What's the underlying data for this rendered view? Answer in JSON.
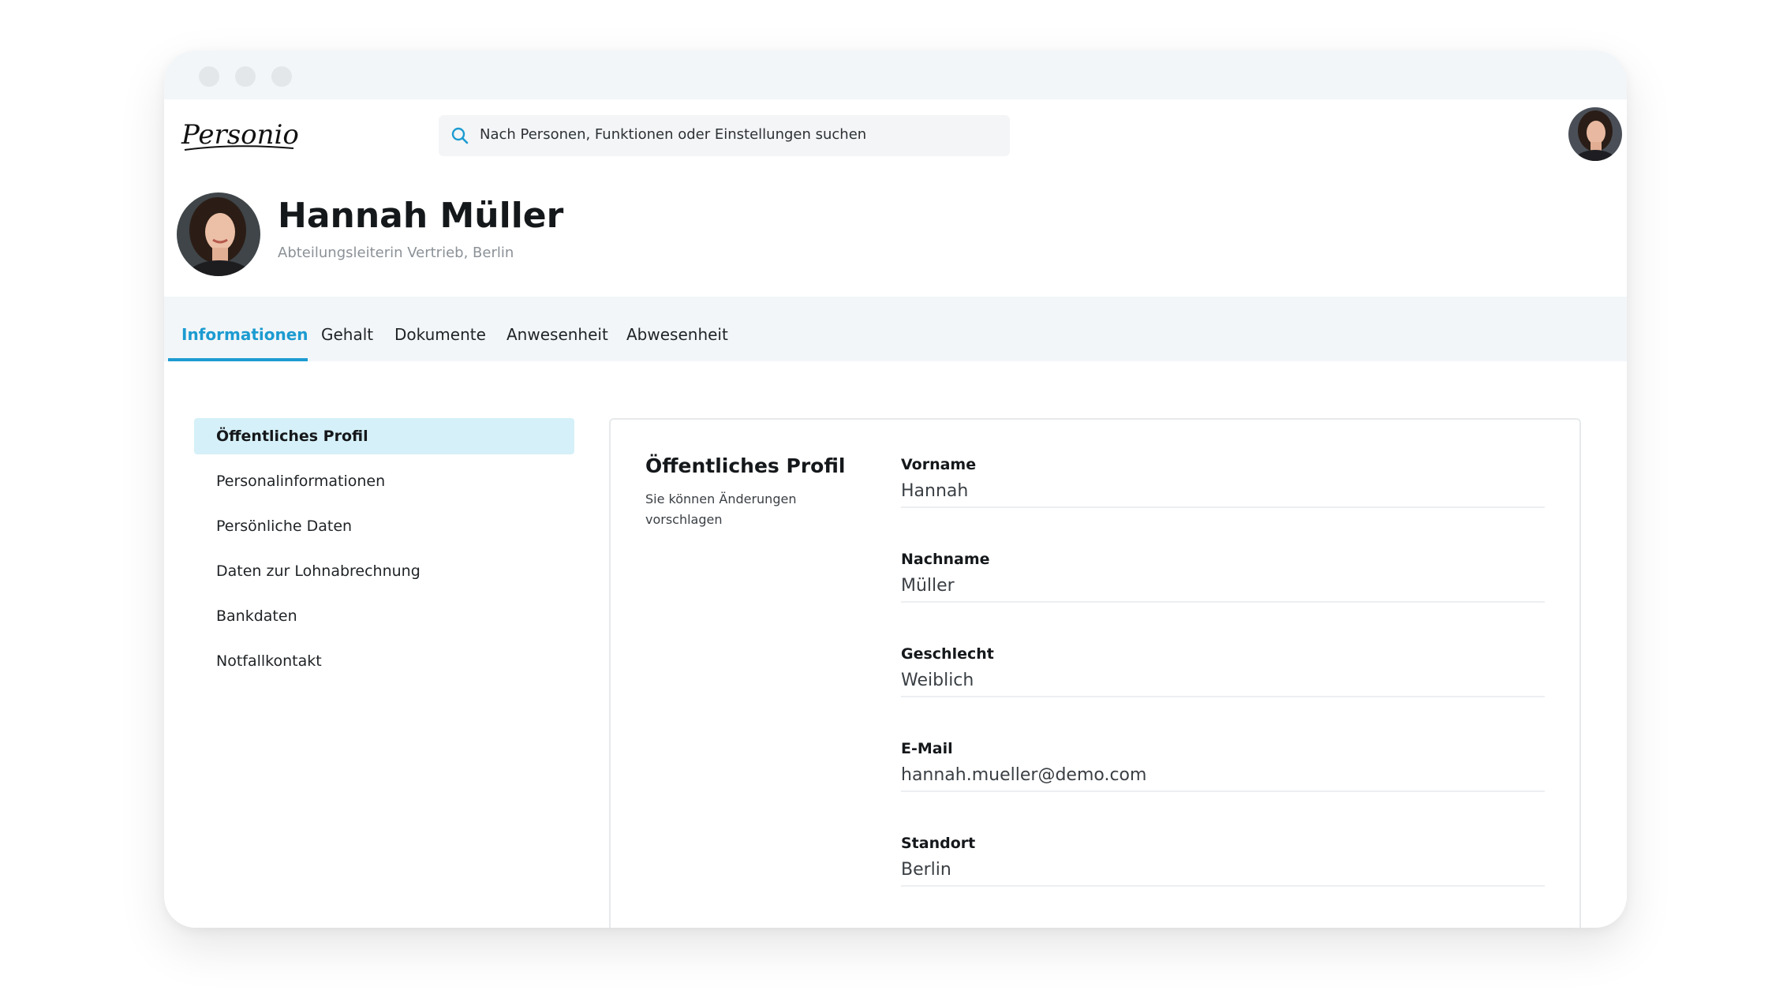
{
  "header": {
    "logo_text": "Personio",
    "search_placeholder": "Nach Personen, Funktionen oder Einstellungen suchen"
  },
  "profile": {
    "name": "Hannah Müller",
    "role": "Abteilungsleiterin Vertrieb, Berlin"
  },
  "tabs": [
    {
      "label": "Informationen",
      "active": true
    },
    {
      "label": "Gehalt",
      "active": false
    },
    {
      "label": "Dokumente",
      "active": false
    },
    {
      "label": "Anwesenheit",
      "active": false
    },
    {
      "label": "Abwesenheit",
      "active": false
    }
  ],
  "sidebar": {
    "items": [
      {
        "label": "Öffentliches Profil",
        "active": true
      },
      {
        "label": "Personalinformationen",
        "active": false
      },
      {
        "label": "Persönliche Daten",
        "active": false
      },
      {
        "label": "Daten zur Lohnabrechnung",
        "active": false
      },
      {
        "label": "Bankdaten",
        "active": false
      },
      {
        "label": "Notfallkontakt",
        "active": false
      }
    ]
  },
  "card": {
    "title": "Öffentliches Profil",
    "subtitle": "Sie können Änderungen vorschlagen",
    "fields": [
      {
        "label": "Vorname",
        "value": "Hannah"
      },
      {
        "label": "Nachname",
        "value": "Müller"
      },
      {
        "label": "Geschlecht",
        "value": "Weiblich"
      },
      {
        "label": "E-Mail",
        "value": "hannah.mueller@demo.com"
      },
      {
        "label": "Standort",
        "value": "Berlin"
      }
    ]
  },
  "colors": {
    "accent": "#1c9bd1",
    "active_nav_bg": "#d5f0f8",
    "tabbar_bg": "#f3f6f8"
  },
  "icons": {
    "search": "search-icon",
    "avatar": "avatar"
  }
}
